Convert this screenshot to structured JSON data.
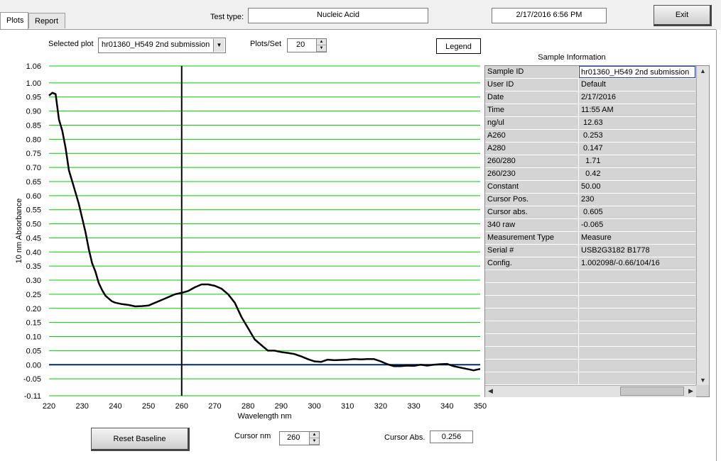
{
  "tabs": [
    {
      "label": "Plots",
      "active": true
    },
    {
      "label": "Report",
      "active": false
    }
  ],
  "header": {
    "test_type_label": "Test type:",
    "test_type_value": "Nucleic Acid",
    "datetime": "2/17/2016  6:56 PM",
    "exit_label": "Exit"
  },
  "controls": {
    "selected_plot_label": "Selected plot",
    "selected_plot_value": "hr01360_H549 2nd submission",
    "plots_per_set_label": "Plots/Set",
    "plots_per_set_value": "20",
    "legend_label": "Legend"
  },
  "bottom": {
    "reset_baseline_label": "Reset Baseline",
    "cursor_nm_label": "Cursor nm",
    "cursor_nm_value": "260",
    "cursor_abs_label": "Cursor Abs.",
    "cursor_abs_value": "0.256"
  },
  "sample_info": {
    "title": "Sample Information",
    "rows": [
      {
        "key": "Sample ID",
        "value": "hr01360_H549 2nd submission"
      },
      {
        "key": "User ID",
        "value": "Default"
      },
      {
        "key": "Date",
        "value": "2/17/2016"
      },
      {
        "key": "Time",
        "value": "11:55 AM"
      },
      {
        "key": "ng/ul",
        "value": " 12.63"
      },
      {
        "key": "A260",
        "value": " 0.253"
      },
      {
        "key": "A280",
        "value": " 0.147"
      },
      {
        "key": "260/280",
        "value": "  1.71"
      },
      {
        "key": "260/230",
        "value": "  0.42"
      },
      {
        "key": "Constant",
        "value": "50.00"
      },
      {
        "key": "Cursor Pos.",
        "value": "230"
      },
      {
        "key": "Cursor abs.",
        "value": " 0.605"
      },
      {
        "key": "340 raw",
        "value": "-0.065"
      },
      {
        "key": "Measurement Type",
        "value": "Measure"
      },
      {
        "key": "Serial #",
        "value": "USB2G3182 B1778"
      },
      {
        "key": "Config.",
        "value": "1.002098/-0.66/104/16"
      }
    ]
  },
  "colors": {
    "grid": "#00cc00",
    "baseline": "#002a6e",
    "trace": "#000000",
    "cursor": "#000000"
  },
  "chart_data": {
    "type": "line",
    "xlabel": "Wavelength nm",
    "ylabel": "10 nm Absorbance",
    "xlim": [
      220,
      350
    ],
    "ylim": [
      -0.11,
      1.06
    ],
    "x_ticks": [
      220,
      230,
      240,
      250,
      260,
      270,
      280,
      290,
      300,
      310,
      320,
      330,
      340,
      350
    ],
    "y_ticks": [
      -0.11,
      -0.05,
      0.0,
      0.05,
      0.1,
      0.15,
      0.2,
      0.25,
      0.3,
      0.35,
      0.4,
      0.45,
      0.5,
      0.55,
      0.6,
      0.65,
      0.7,
      0.75,
      0.8,
      0.85,
      0.9,
      0.95,
      1.0,
      1.06
    ],
    "y_tick_labels": [
      "-0.11",
      "-0.05",
      "0.00",
      "0.05",
      "0.10",
      "0.15",
      "0.20",
      "0.25",
      "0.30",
      "0.35",
      "0.40",
      "0.45",
      "0.50",
      "0.55",
      "0.60",
      "0.65",
      "0.70",
      "0.75",
      "0.80",
      "0.85",
      "0.90",
      "0.95",
      "1.00",
      "1.06"
    ],
    "grid": true,
    "baseline_y": 0.0,
    "cursor_x": 260,
    "series": [
      {
        "x": [
          220,
          221,
          222,
          223,
          224,
          225,
          226,
          227,
          228,
          229,
          230,
          231,
          232,
          233,
          234,
          235,
          236,
          237,
          238,
          239,
          240,
          242,
          244,
          246,
          248,
          250,
          252,
          254,
          256,
          258,
          260,
          262,
          264,
          266,
          268,
          270,
          272,
          274,
          276,
          278,
          280,
          282,
          284,
          286,
          288,
          290,
          292,
          294,
          296,
          298,
          300,
          302,
          304,
          306,
          308,
          310,
          312,
          314,
          316,
          318,
          320,
          322,
          324,
          326,
          328,
          330,
          332,
          334,
          336,
          338,
          340,
          342,
          344,
          346,
          348,
          350
        ],
        "y": [
          0.955,
          0.965,
          0.96,
          0.87,
          0.83,
          0.77,
          0.69,
          0.65,
          0.61,
          0.57,
          0.52,
          0.47,
          0.41,
          0.36,
          0.33,
          0.29,
          0.265,
          0.245,
          0.235,
          0.225,
          0.22,
          0.215,
          0.212,
          0.207,
          0.208,
          0.21,
          0.22,
          0.23,
          0.24,
          0.25,
          0.255,
          0.262,
          0.275,
          0.285,
          0.285,
          0.28,
          0.27,
          0.25,
          0.22,
          0.17,
          0.13,
          0.09,
          0.07,
          0.05,
          0.05,
          0.045,
          0.042,
          0.038,
          0.03,
          0.02,
          0.012,
          0.01,
          0.018,
          0.016,
          0.017,
          0.018,
          0.02,
          0.019,
          0.02,
          0.02,
          0.012,
          0.002,
          -0.005,
          -0.005,
          -0.003,
          -0.004,
          0.0,
          -0.003,
          0.0,
          0.002,
          0.003,
          -0.005,
          -0.01,
          -0.015,
          -0.02,
          -0.015
        ]
      }
    ]
  }
}
